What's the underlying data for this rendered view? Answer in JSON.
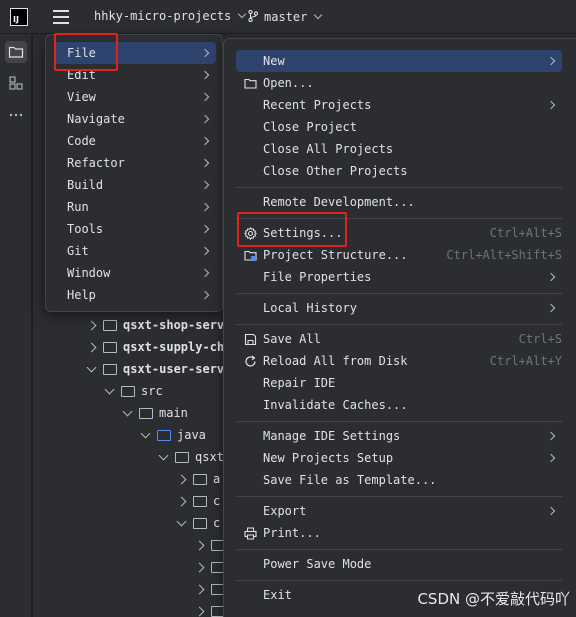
{
  "titlebar": {
    "logo_text": "IJ",
    "project": "hhky-micro-projects",
    "branch": "master"
  },
  "tree": {
    "rows": [
      {
        "label": "qsxt-shop-serv",
        "bold": true
      },
      {
        "label": "qsxt-supply-ch",
        "bold": true
      },
      {
        "label": "qsxt-user-serv",
        "bold": true
      },
      {
        "label": "src",
        "bold": false
      },
      {
        "label": "main",
        "bold": false
      },
      {
        "label": "java",
        "bold": false
      },
      {
        "label": "qsxt",
        "bold": false
      },
      {
        "label": "a",
        "bold": false
      },
      {
        "label": "c",
        "bold": false
      },
      {
        "label": "c",
        "bold": false
      }
    ]
  },
  "main_menu": {
    "items": [
      {
        "label": "File"
      },
      {
        "label": "Edit"
      },
      {
        "label": "View"
      },
      {
        "label": "Navigate"
      },
      {
        "label": "Code"
      },
      {
        "label": "Refactor"
      },
      {
        "label": "Build"
      },
      {
        "label": "Run"
      },
      {
        "label": "Tools"
      },
      {
        "label": "Git"
      },
      {
        "label": "Window"
      },
      {
        "label": "Help"
      }
    ]
  },
  "file_menu": {
    "items": {
      "new": {
        "label": "New"
      },
      "open": {
        "label": "Open..."
      },
      "recent_projects": {
        "label": "Recent Projects"
      },
      "close_project": {
        "label": "Close Project"
      },
      "close_all_projects": {
        "label": "Close All Projects"
      },
      "close_other_projects": {
        "label": "Close Other Projects"
      },
      "remote_development": {
        "label": "Remote Development..."
      },
      "settings": {
        "label": "Settings...",
        "shortcut": "Ctrl+Alt+S"
      },
      "project_structure": {
        "label": "Project Structure...",
        "shortcut": "Ctrl+Alt+Shift+S"
      },
      "file_properties": {
        "label": "File Properties"
      },
      "local_history": {
        "label": "Local History"
      },
      "save_all": {
        "label": "Save All",
        "shortcut": "Ctrl+S"
      },
      "reload_all": {
        "label": "Reload All from Disk",
        "shortcut": "Ctrl+Alt+Y"
      },
      "repair_ide": {
        "label": "Repair IDE"
      },
      "invalidate_caches": {
        "label": "Invalidate Caches..."
      },
      "manage_ide_settings": {
        "label": "Manage IDE Settings"
      },
      "new_projects_setup": {
        "label": "New Projects Setup"
      },
      "save_file_as_template": {
        "label": "Save File as Template..."
      },
      "export": {
        "label": "Export"
      },
      "print": {
        "label": "Print..."
      },
      "power_save_mode": {
        "label": "Power Save Mode"
      },
      "exit": {
        "label": "Exit"
      }
    }
  },
  "watermark": "CSDN @不爱敲代码吖",
  "colors": {
    "background": "#1e1f22",
    "panel": "#2b2d30",
    "selection": "#2e436e",
    "highlight_box": "#e3221c",
    "text": "#dfe1e5",
    "shortcut_text": "#6f737a"
  }
}
